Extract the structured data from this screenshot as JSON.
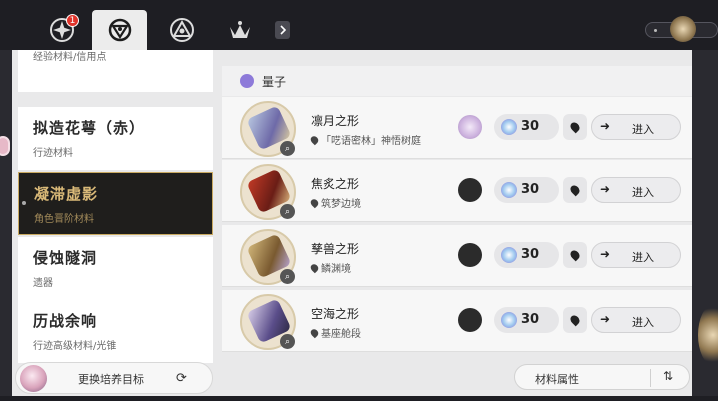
{
  "tabs": [
    {
      "icon": "compass-shield-icon",
      "badge": "1"
    },
    {
      "icon": "navigation-icon",
      "active": true
    },
    {
      "icon": "triangle-emblem-icon"
    },
    {
      "icon": "crown-emblem-icon"
    }
  ],
  "sidebar": {
    "items": [
      {
        "title": "",
        "subtitle": "经验材料/信用点"
      },
      {
        "title": "拟造花萼（赤）",
        "subtitle": "行迹材料"
      },
      {
        "title": "凝滞虚影",
        "subtitle": "角色晋阶材料",
        "active": true
      },
      {
        "title": "侵蚀隧洞",
        "subtitle": "遗器"
      },
      {
        "title": "历战余响",
        "subtitle": "行迹高级材料/光锥"
      }
    ],
    "change_target_label": "更换培养目标"
  },
  "list": {
    "header": "量子",
    "rows": [
      {
        "name": "凛月之形",
        "location": "「呓语密林」神悟树庭",
        "cost": "30",
        "enter": "进入",
        "enemy_icon": "special-avatar-icon"
      },
      {
        "name": "焦炙之形",
        "location": "筑梦边境",
        "cost": "30",
        "enter": "进入",
        "enemy_icon": "enemy-icon"
      },
      {
        "name": "孳兽之形",
        "location": "鳞渊境",
        "cost": "30",
        "enter": "进入",
        "enemy_icon": "enemy-icon"
      },
      {
        "name": "空海之形",
        "location": "基座舱段",
        "cost": "30",
        "enter": "进入",
        "enemy_icon": "enemy-icon"
      }
    ]
  },
  "sort": {
    "label": "材料属性"
  },
  "colors": {
    "accent_gold": "#c9a960",
    "active_bg": "#1f1e1c",
    "quantum_purple": "#8d7ad9"
  }
}
